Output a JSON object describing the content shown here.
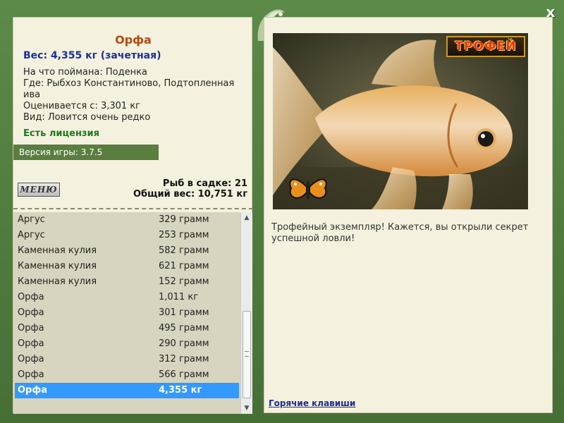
{
  "close_label": "x",
  "fish": {
    "title": "Орфа",
    "weight": "Вес: 4,355 кг (зачетная)",
    "caught_on": "На что поймана: Поденка",
    "where": "Где: Рыбхоз Константиново, Подтопленная ива",
    "rated_from": "Оцениваетcя с: 3,301 кг",
    "kind": "Вид: Ловится очень редко"
  },
  "license": "Есть лицензия",
  "version": "Версия игры: 3.7.5",
  "menu_label": "МЕНЮ",
  "cage": {
    "count": "Рыб в садке: 21",
    "total": "Общий вес: 10,751 кг"
  },
  "catch_list": [
    {
      "name": "Аргус",
      "weight": "329 грамм"
    },
    {
      "name": "Аргус",
      "weight": "253 грамм"
    },
    {
      "name": "Каменная кулия",
      "weight": "582 грамм"
    },
    {
      "name": "Каменная кулия",
      "weight": "621 грамм"
    },
    {
      "name": "Каменная кулия",
      "weight": "152 грамм"
    },
    {
      "name": "Орфа",
      "weight": "1,011 кг"
    },
    {
      "name": "Орфа",
      "weight": "301 грамм"
    },
    {
      "name": "Орфа",
      "weight": "495 грамм"
    },
    {
      "name": "Орфа",
      "weight": "290 грамм"
    },
    {
      "name": "Орфа",
      "weight": "312 грамм"
    },
    {
      "name": "Орфа",
      "weight": "566 грамм"
    },
    {
      "name": "Орфа",
      "weight": "4,355 кг",
      "selected": true
    }
  ],
  "trophy": {
    "badge": "ТРОФЕЙ",
    "message": "Трофейный экземпляр! Кажется, вы открыли секрет успешной ловли!"
  },
  "hotkeys_label": "Горячие клавиши",
  "colors": {
    "frame": "#4f7a3e",
    "panel": "#f4f2de",
    "list_bg": "#d7d5bf",
    "selected_row": "#3399ff",
    "title": "#b34a12",
    "weight": "#1b2fa0",
    "license": "#1c7a1c"
  }
}
